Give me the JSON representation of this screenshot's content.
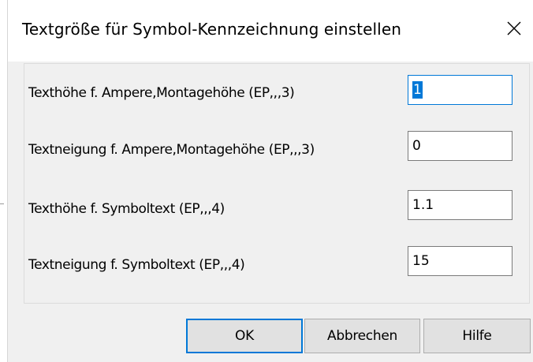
{
  "dialog": {
    "title": "Textgröße für Symbol-Kennzeichnung einstellen",
    "close_icon": "close-icon"
  },
  "fields": [
    {
      "label": "Texthöhe f. Ampere,Montagehöhe (EP,,,3)",
      "value": "1",
      "focused": true
    },
    {
      "label": "Textneigung f. Ampere,Montagehöhe (EP,,,3)",
      "value": "0",
      "focused": false
    },
    {
      "label": "Texthöhe f. Symboltext (EP,,,4)",
      "value": "1.1",
      "focused": false
    },
    {
      "label": "Textneigung f. Symboltext (EP,,,4)",
      "value": "15",
      "focused": false
    }
  ],
  "buttons": {
    "ok_label": "OK",
    "cancel_label": "Abbrechen",
    "help_label": "Hilfe"
  },
  "colors": {
    "accent": "#0078d7",
    "window_background": "#f0f0f0",
    "titlebar_background": "#ffffff"
  }
}
